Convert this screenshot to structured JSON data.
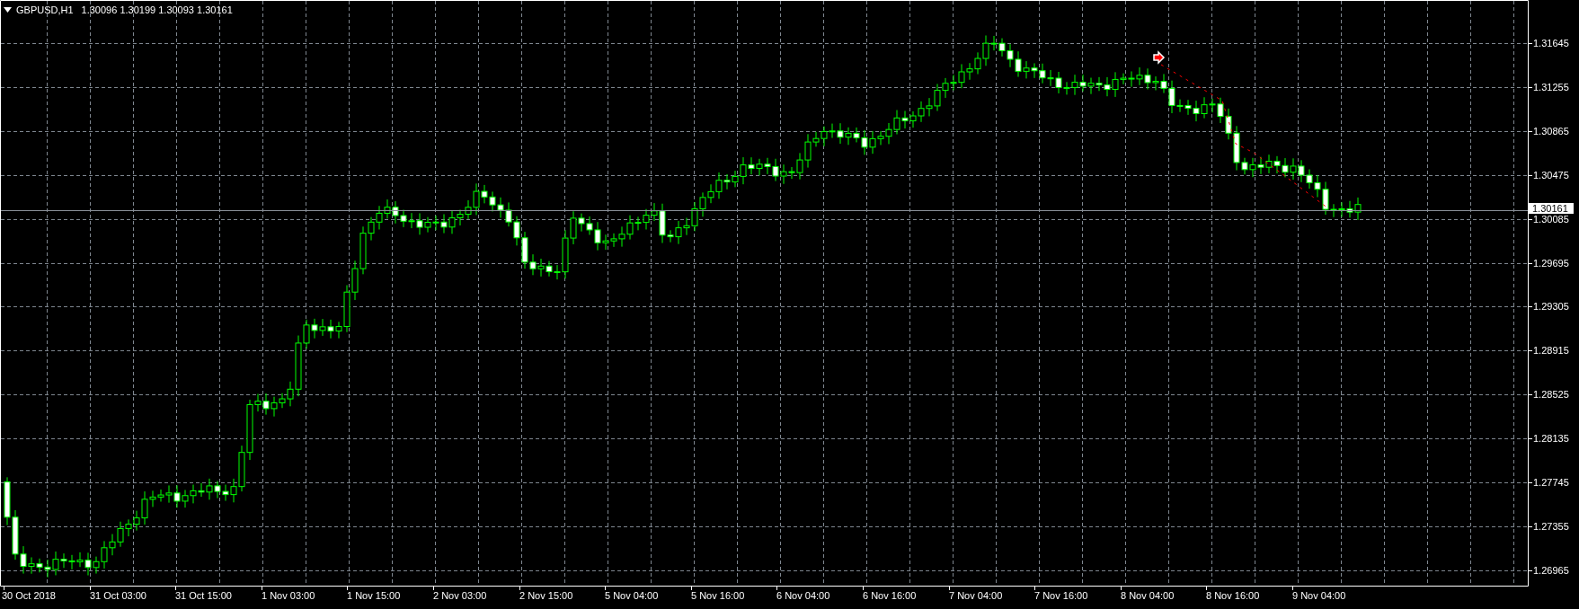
{
  "chart_header": {
    "symbol": "GBPUSD,H1",
    "ohlc": [
      "1.30096",
      "1.30199",
      "1.30093",
      "1.30161"
    ]
  },
  "price_axis": [
    "1.31645",
    "1.31255",
    "1.30865",
    "1.30475",
    "1.30085",
    "1.29695",
    "1.29305",
    "1.28915",
    "1.28525",
    "1.28135",
    "1.27745",
    "1.27355",
    "1.26965"
  ],
  "current_price": "1.30161",
  "time_axis": [
    "30 Oct 2018",
    "31 Oct 03:00",
    "31 Oct 15:00",
    "1 Nov 03:00",
    "1 Nov 15:00",
    "2 Nov 03:00",
    "2 Nov 15:00",
    "5 Nov 04:00",
    "5 Nov 16:00",
    "6 Nov 04:00",
    "6 Nov 16:00",
    "7 Nov 04:00",
    "7 Nov 16:00",
    "8 Nov 04:00",
    "8 Nov 16:00",
    "9 Nov 04:00"
  ]
}
